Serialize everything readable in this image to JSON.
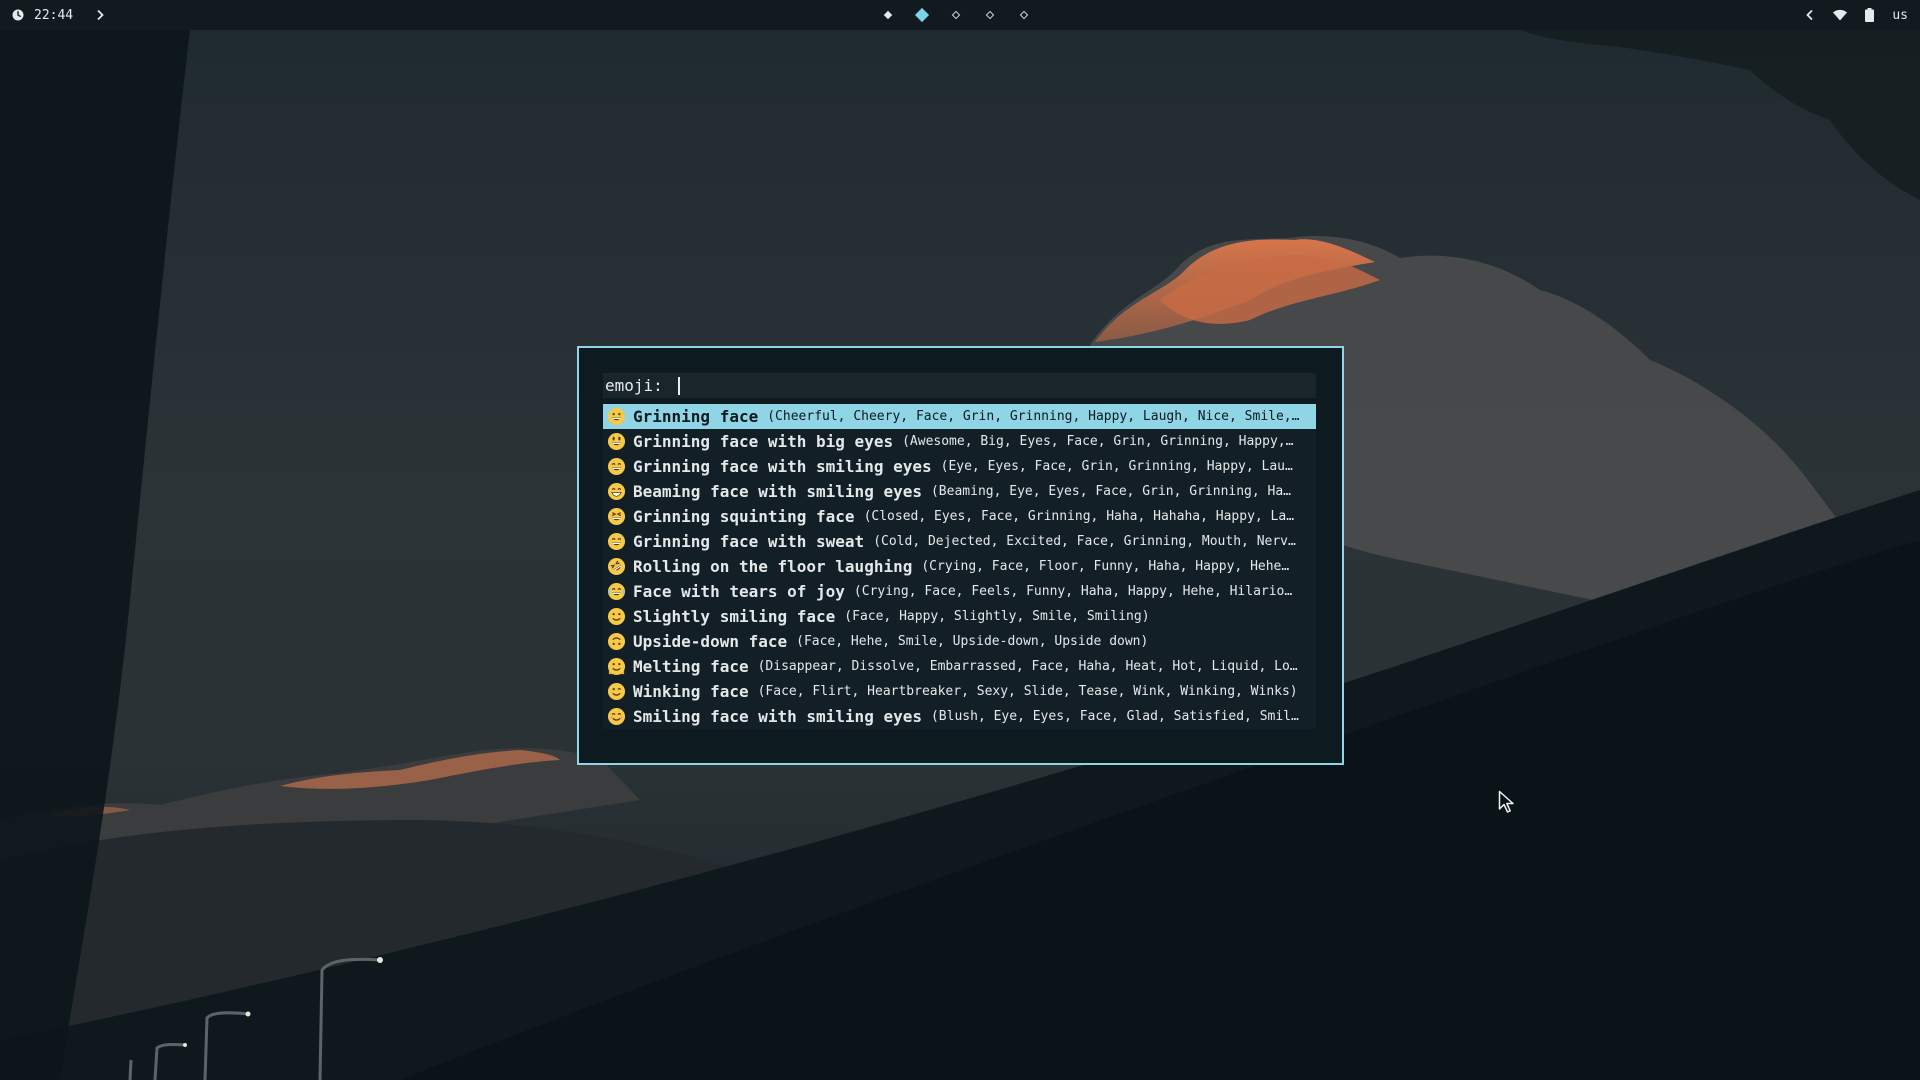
{
  "topbar": {
    "clock_icon": "clock-icon",
    "time": "22:44",
    "expand_icon": "chevron-right-icon",
    "workspaces": [
      {
        "id": 1,
        "state": "occupied"
      },
      {
        "id": 2,
        "state": "active"
      },
      {
        "id": 3,
        "state": "empty"
      },
      {
        "id": 4,
        "state": "empty"
      },
      {
        "id": 5,
        "state": "empty"
      }
    ],
    "tray": {
      "collapse_icon": "chevron-left-icon",
      "wifi_icon": "wifi-icon",
      "battery_icon": "battery-icon",
      "keyboard_layout": "us"
    }
  },
  "launcher": {
    "prompt_label": "emoji: ",
    "query": "",
    "accent_color": "#8fd5e6",
    "background_color": "#0d1a20",
    "results": [
      {
        "icon": "grinning-face-icon",
        "name": "Grinning face",
        "keywords": "(Cheerful, Cheery, Face, Grin, Grinning, Happy, Laugh, Nice, Smile,…",
        "selected": true
      },
      {
        "icon": "grinning-face-big-eyes-icon",
        "name": "Grinning face with big eyes",
        "keywords": "(Awesome, Big, Eyes, Face, Grin, Grinning, Happy,…",
        "selected": false
      },
      {
        "icon": "grinning-face-smiling-eyes-icon",
        "name": "Grinning face with smiling eyes",
        "keywords": "(Eye, Eyes, Face, Grin, Grinning, Happy, Lau…",
        "selected": false
      },
      {
        "icon": "beaming-face-icon",
        "name": "Beaming face with smiling eyes",
        "keywords": "(Beaming, Eye, Eyes, Face, Grin, Grinning, Ha…",
        "selected": false
      },
      {
        "icon": "grinning-squinting-face-icon",
        "name": "Grinning squinting face",
        "keywords": "(Closed, Eyes, Face, Grinning, Haha, Hahaha, Happy, La…",
        "selected": false
      },
      {
        "icon": "grinning-face-sweat-icon",
        "name": "Grinning face with sweat",
        "keywords": "(Cold, Dejected, Excited, Face, Grinning, Mouth, Nerv…",
        "selected": false
      },
      {
        "icon": "rolling-on-floor-laughing-icon",
        "name": "Rolling on the floor laughing",
        "keywords": "(Crying, Face, Floor, Funny, Haha, Happy, Hehe…",
        "selected": false
      },
      {
        "icon": "face-tears-of-joy-icon",
        "name": "Face with tears of joy",
        "keywords": "(Crying, Face, Feels, Funny, Haha, Happy, Hehe, Hilario…",
        "selected": false
      },
      {
        "icon": "slightly-smiling-face-icon",
        "name": "Slightly smiling face",
        "keywords": "(Face, Happy, Slightly, Smile, Smiling)",
        "selected": false
      },
      {
        "icon": "upside-down-face-icon",
        "name": "Upside-down face",
        "keywords": "(Face, Hehe, Smile, Upside-down, Upside down)",
        "selected": false
      },
      {
        "icon": "melting-face-icon",
        "name": "Melting face",
        "keywords": "(Disappear, Dissolve, Embarrassed, Face, Haha, Heat, Hot, Liquid, Lo…",
        "selected": false
      },
      {
        "icon": "winking-face-icon",
        "name": "Winking face",
        "keywords": "(Face, Flirt, Heartbreaker, Sexy, Slide, Tease, Wink, Winking, Winks)",
        "selected": false
      },
      {
        "icon": "smiling-face-smiling-eyes-icon",
        "name": "Smiling face with smiling eyes",
        "keywords": "(Blush, Eye, Eyes, Face, Glad, Satisfied, Smil…",
        "selected": false
      }
    ]
  }
}
